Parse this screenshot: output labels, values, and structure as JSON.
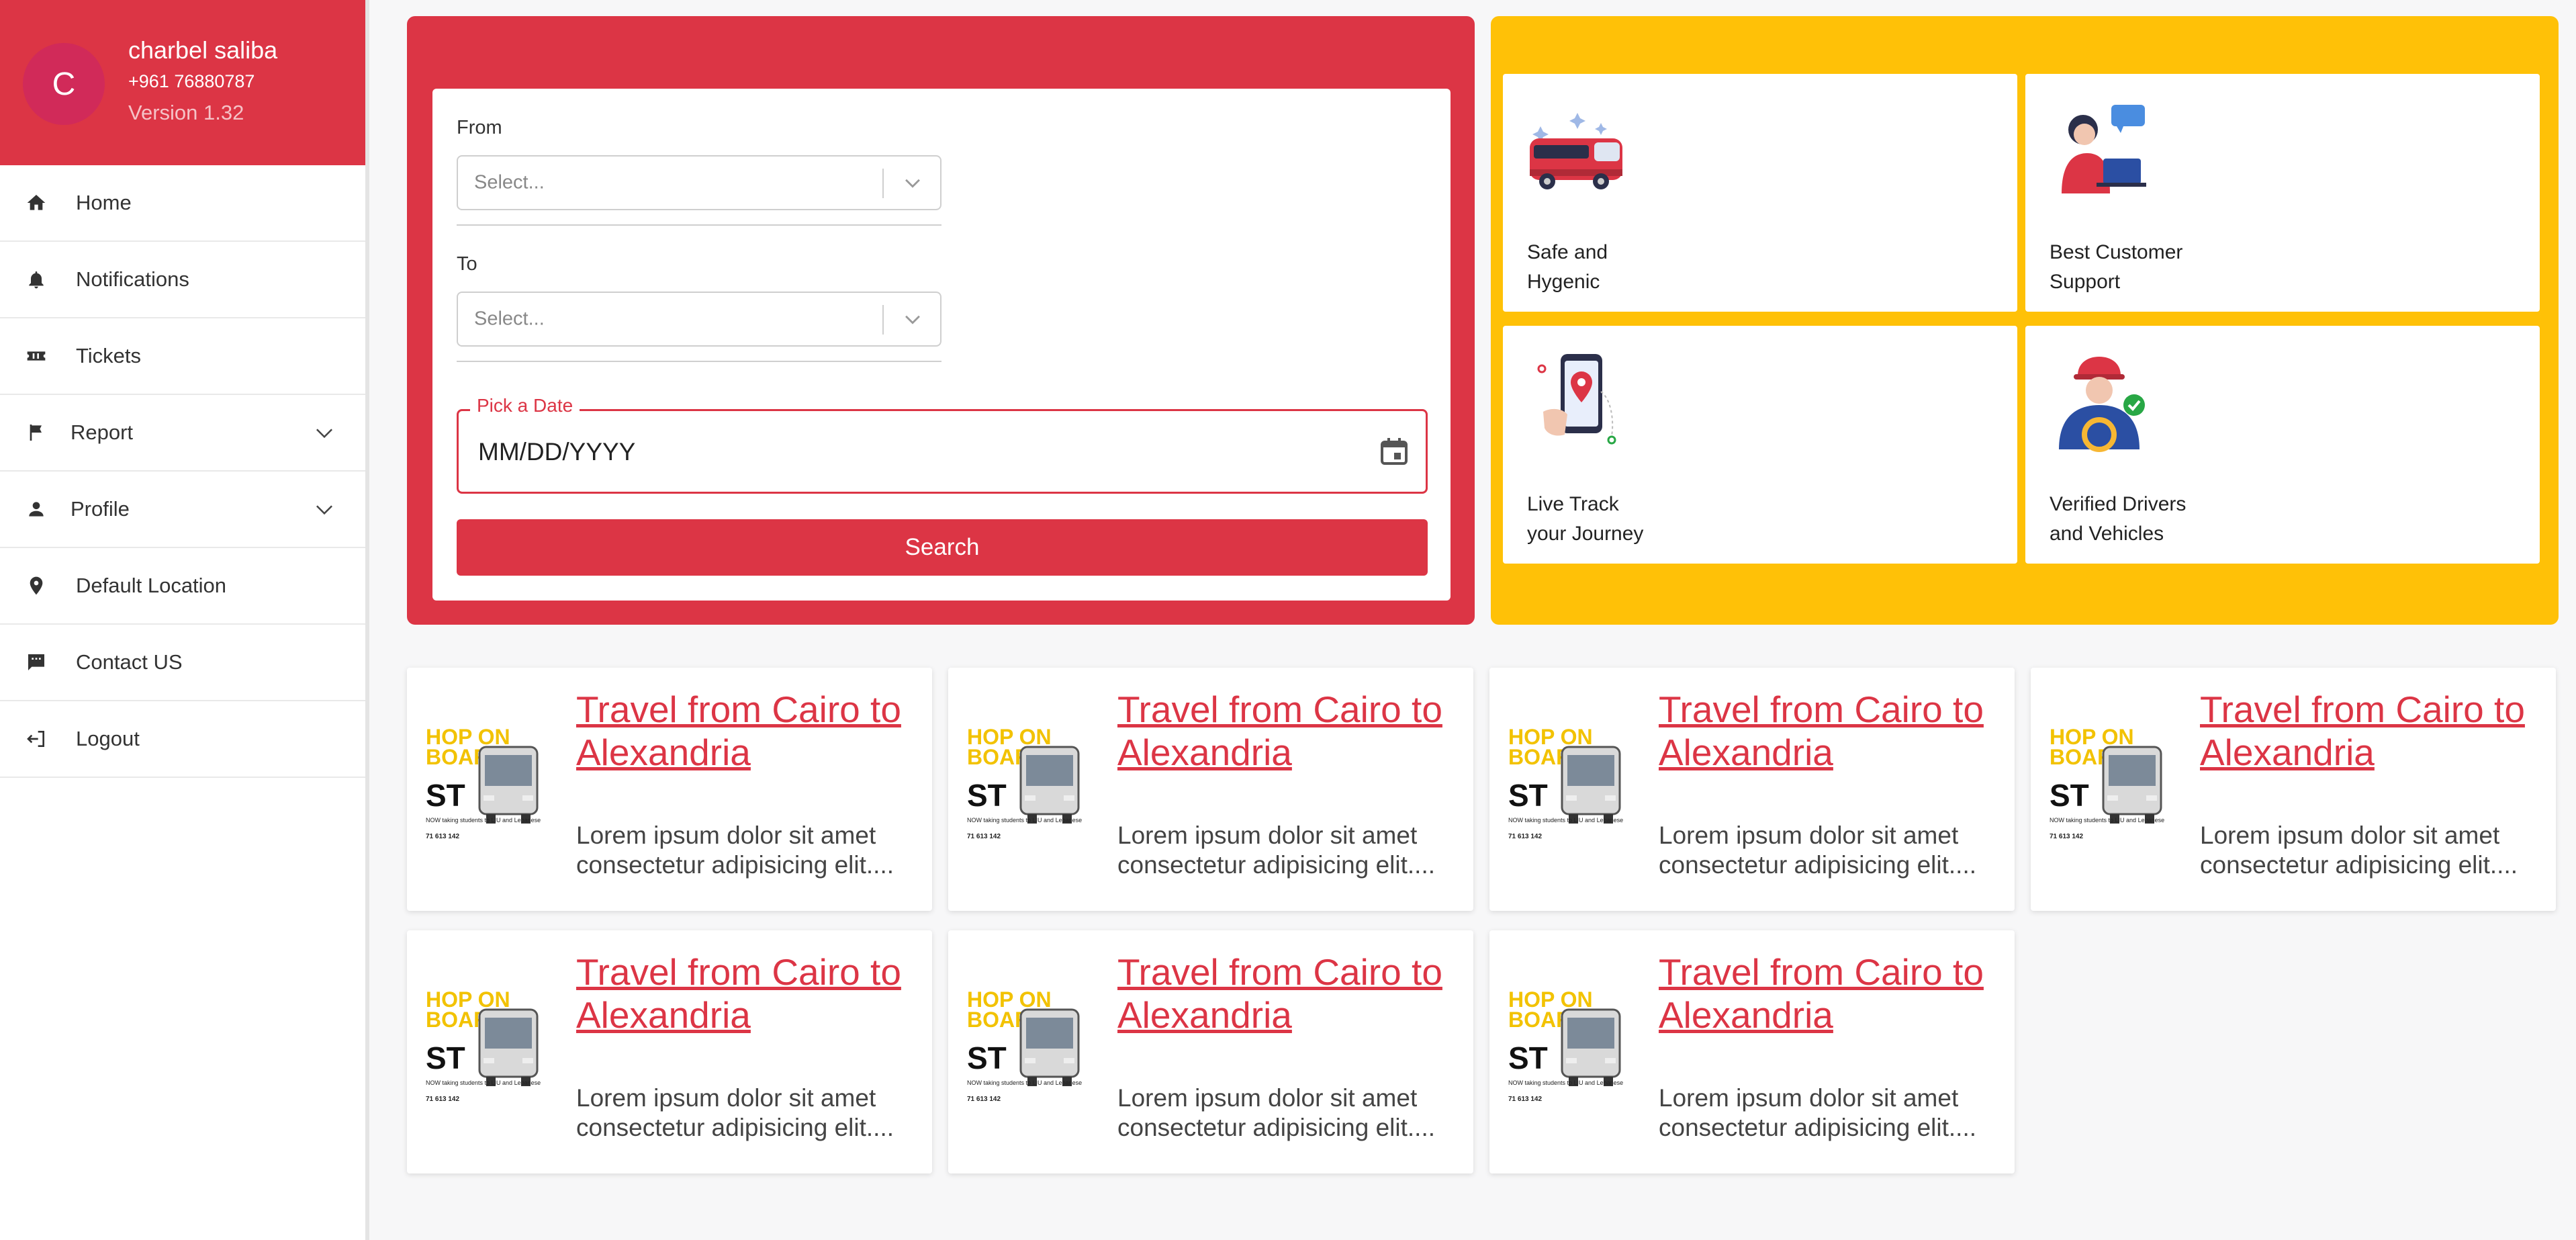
{
  "user": {
    "initial": "C",
    "name": "charbel saliba",
    "phone": "+961 76880787",
    "version": "Version 1.32"
  },
  "nav": [
    {
      "label": "Home",
      "icon": "home-icon"
    },
    {
      "label": "Notifications",
      "icon": "bell-icon"
    },
    {
      "label": "Tickets",
      "icon": "ticket-icon"
    },
    {
      "label": "Report",
      "icon": "flag-icon",
      "expandable": true
    },
    {
      "label": "Profile",
      "icon": "person-icon",
      "expandable": true
    },
    {
      "label": "Default Location",
      "icon": "location-pin-icon"
    },
    {
      "label": "Contact US",
      "icon": "chat-icon"
    },
    {
      "label": "Logout",
      "icon": "logout-icon"
    }
  ],
  "search": {
    "from_label": "From",
    "from_placeholder": "Select...",
    "to_label": "To",
    "to_placeholder": "Select...",
    "date_label": "Pick a Date",
    "date_value": "MM/DD/YYYY",
    "button": "Search"
  },
  "features": [
    {
      "line1": "Safe and",
      "line2": "Hygenic",
      "icon": "bus-icon"
    },
    {
      "line1": "Best Customer",
      "line2": "Support",
      "icon": "support-agent-icon"
    },
    {
      "line1": "Live Track",
      "line2": "your Journey",
      "icon": "phone-map-pin-icon"
    },
    {
      "line1": "Verified Drivers",
      "line2": "and Vehicles",
      "icon": "verified-driver-icon"
    }
  ],
  "trips": [
    {
      "title": "Travel from Cairo to Alexandria",
      "desc": "Lorem ipsum dolor sit amet consectetur adipisicing elit...."
    },
    {
      "title": "Travel from Cairo to Alexandria",
      "desc": "Lorem ipsum dolor sit amet consectetur adipisicing elit...."
    },
    {
      "title": "Travel from Cairo to Alexandria",
      "desc": "Lorem ipsum dolor sit amet consectetur adipisicing elit...."
    },
    {
      "title": "Travel from Cairo to Alexandria",
      "desc": "Lorem ipsum dolor sit amet consectetur adipisicing elit...."
    },
    {
      "title": "Travel from Cairo to Alexandria",
      "desc": "Lorem ipsum dolor sit amet consectetur adipisicing elit...."
    },
    {
      "title": "Travel from Cairo to Alexandria",
      "desc": "Lorem ipsum dolor sit amet consectetur adipisicing elit...."
    },
    {
      "title": "Travel from Cairo to Alexandria",
      "desc": "Lorem ipsum dolor sit amet consectetur adipisicing elit...."
    }
  ],
  "promo": {
    "line1": "HOP ON",
    "line2": "BOARD",
    "brand": "ST",
    "tagline": "NOW taking students to LIU and Lebanese universities!",
    "phone": "71 613 142"
  },
  "colors": {
    "primary": "#dc3545",
    "accent": "#ffc107",
    "avatar": "#d12a59"
  }
}
